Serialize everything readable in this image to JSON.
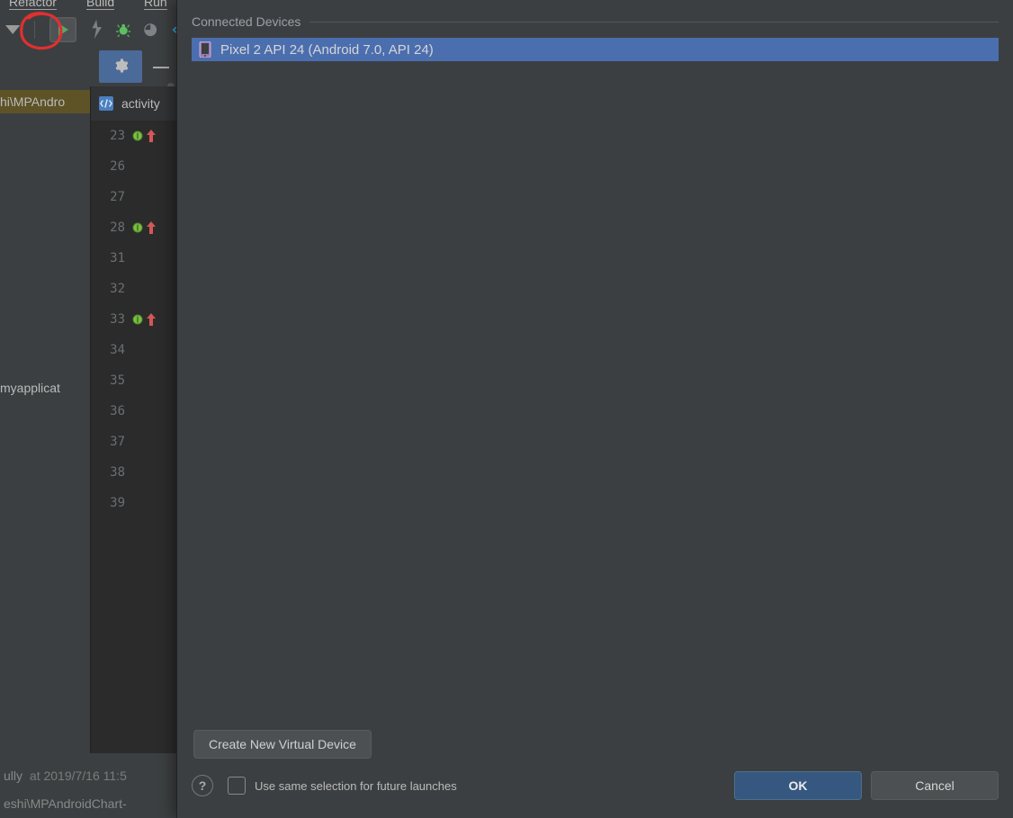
{
  "menu": {
    "refactor": "Refactor",
    "build": "Build",
    "run": "Run"
  },
  "toolbar": {
    "run_label": "Run",
    "debug_label": "Debug",
    "profile_label": "Profile",
    "apply_label": "Apply Changes"
  },
  "project": {
    "path_partial": "hi\\MPAndro",
    "app_name_partial": "myapplicat"
  },
  "tabs": {
    "active": "activity"
  },
  "gutter": {
    "lines": [
      "23",
      "26",
      "27",
      "28",
      "31",
      "32",
      "33",
      "34",
      "35",
      "36",
      "37",
      "38",
      "39"
    ],
    "marks": {
      "23": "info",
      "28": "info",
      "33": "info"
    }
  },
  "console": {
    "msg_prefix": "ully",
    "time_label": "at 2019/7/16 11:5",
    "path_partial": "eshi\\MPAndroidChart-"
  },
  "dialog": {
    "section_title": "Connected Devices",
    "devices": [
      {
        "label": "Pixel 2 API 24 (Android 7.0, API 24)"
      }
    ],
    "create_label": "Create New Virtual Device",
    "checkbox_label": "Use same selection for future launches",
    "ok": "OK",
    "cancel": "Cancel"
  }
}
